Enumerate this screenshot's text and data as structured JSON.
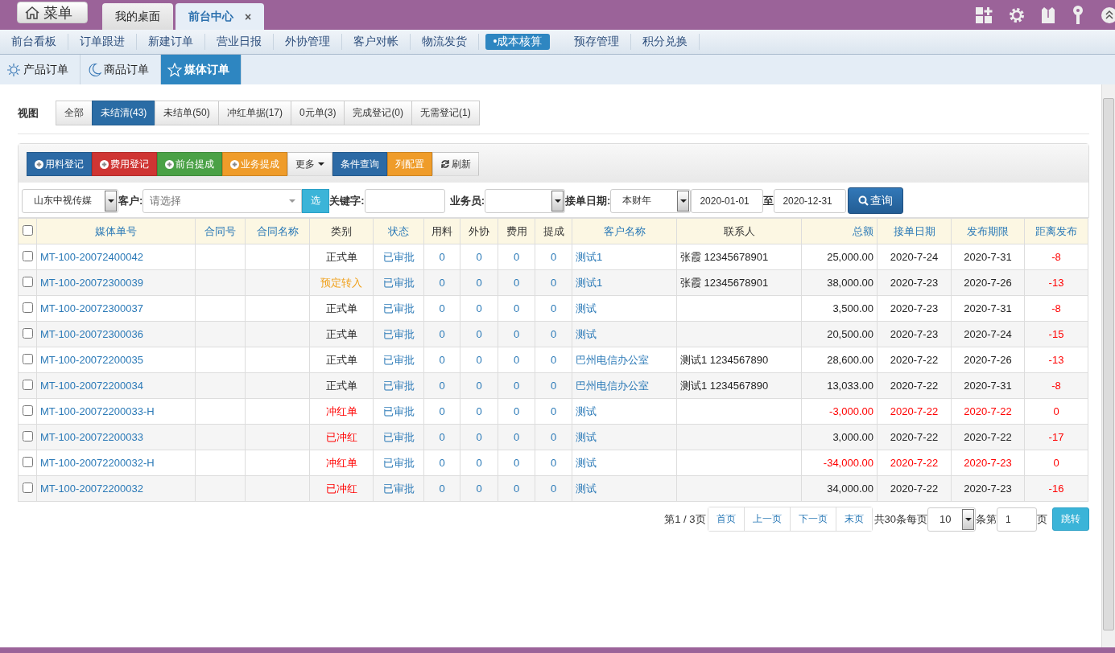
{
  "menu_button": "菜单",
  "window_tabs": [
    {
      "label": "我的桌面",
      "selected": false
    },
    {
      "label": "前台中心",
      "selected": true,
      "close": "×"
    }
  ],
  "nav": [
    {
      "label": "前台看板",
      "selected": false
    },
    {
      "label": "订单跟进",
      "selected": false
    },
    {
      "label": "新建订单",
      "selected": false
    },
    {
      "label": "营业日报",
      "selected": false
    },
    {
      "label": "外协管理",
      "selected": false
    },
    {
      "label": "客户对帐",
      "selected": false
    },
    {
      "label": "物流发货",
      "selected": false
    },
    {
      "label": "•成本核算",
      "selected": true
    },
    {
      "label": "预存管理",
      "selected": false
    },
    {
      "label": "积分兑换",
      "selected": false
    }
  ],
  "sub_tabs": [
    {
      "label": "产品订单",
      "selected": false
    },
    {
      "label": "商品订单",
      "selected": false
    },
    {
      "label": "媒体订单",
      "selected": true
    }
  ],
  "view": {
    "label": "视图",
    "options": [
      {
        "label": "全部",
        "selected": false
      },
      {
        "label": "未结清(43)",
        "selected": true
      },
      {
        "label": "未结单(50)",
        "selected": false
      },
      {
        "label": "冲红单据(17)",
        "selected": false
      },
      {
        "label": "0元单(3)",
        "selected": false
      },
      {
        "label": "完成登记(0)",
        "selected": false
      },
      {
        "label": "无需登记(1)",
        "selected": false
      }
    ]
  },
  "toolbar": [
    {
      "label": "用料登记",
      "kind": "primary"
    },
    {
      "label": "费用登记",
      "kind": "danger"
    },
    {
      "label": "前台提成",
      "kind": "success"
    },
    {
      "label": "业务提成",
      "kind": "warning"
    },
    {
      "label": "更多",
      "kind": "dropdown"
    },
    {
      "label": "条件查询",
      "kind": "primary"
    },
    {
      "label": "列配置",
      "kind": "warning"
    },
    {
      "label": "刷新",
      "kind": "default"
    }
  ],
  "filters": {
    "company": "山东中视传媒",
    "customer_label": "客户:",
    "customer_placeholder": "请选择",
    "pick_button": "选",
    "keyword_label": "关键字:",
    "salesman_label": "业务员:",
    "date_label": "接单日期:",
    "period": "本财年",
    "date_from": "2020-01-01",
    "to_label": "至",
    "date_to": "2020-12-31",
    "search_button": "查询"
  },
  "table": {
    "header_checked": false,
    "columns": [
      {
        "label": "媒体单号",
        "sortable": true
      },
      {
        "label": "合同号",
        "sortable": true
      },
      {
        "label": "合同名称",
        "sortable": true
      },
      {
        "label": "类别",
        "sortable": false
      },
      {
        "label": "状态",
        "sortable": true
      },
      {
        "label": "用料",
        "sortable": false
      },
      {
        "label": "外协",
        "sortable": false
      },
      {
        "label": "费用",
        "sortable": false
      },
      {
        "label": "提成",
        "sortable": false
      },
      {
        "label": "客户名称",
        "sortable": true
      },
      {
        "label": "联系人",
        "sortable": false
      },
      {
        "label": "总额",
        "sortable": true
      },
      {
        "label": "接单日期",
        "sortable": true
      },
      {
        "label": "发布期限",
        "sortable": true
      },
      {
        "label": "距离发布",
        "sortable": true
      }
    ],
    "rows": [
      {
        "checked": false,
        "kind": "normal",
        "cells": [
          "MT-100-20072400042",
          "",
          "",
          "正式单",
          "已审批",
          "0",
          "0",
          "0",
          "0",
          "测试1",
          "张霞 12345678901",
          "25,000.00",
          "2020-7-24",
          "2020-7-31",
          "-8"
        ]
      },
      {
        "checked": false,
        "kind": "reserved",
        "cells": [
          "MT-100-20072300039",
          "",
          "",
          "预定转入",
          "已审批",
          "0",
          "0",
          "0",
          "0",
          "测试1",
          "张霞 12345678901",
          "38,000.00",
          "2020-7-23",
          "2020-7-26",
          "-13"
        ]
      },
      {
        "checked": false,
        "kind": "normal",
        "cells": [
          "MT-100-20072300037",
          "",
          "",
          "正式单",
          "已审批",
          "0",
          "0",
          "0",
          "0",
          "测试",
          "",
          "3,500.00",
          "2020-7-23",
          "2020-7-31",
          "-8"
        ]
      },
      {
        "checked": false,
        "kind": "normal",
        "cells": [
          "MT-100-20072300036",
          "",
          "",
          "正式单",
          "已审批",
          "0",
          "0",
          "0",
          "0",
          "测试",
          "",
          "20,500.00",
          "2020-7-23",
          "2020-7-24",
          "-15"
        ]
      },
      {
        "checked": false,
        "kind": "normal",
        "cells": [
          "MT-100-20072200035",
          "",
          "",
          "正式单",
          "已审批",
          "0",
          "0",
          "0",
          "0",
          "巴州电信办公室",
          "测试1 1234567890",
          "28,600.00",
          "2020-7-22",
          "2020-7-26",
          "-13"
        ]
      },
      {
        "checked": false,
        "kind": "normal",
        "cells": [
          "MT-100-20072200034",
          "",
          "",
          "正式单",
          "已审批",
          "0",
          "0",
          "0",
          "0",
          "巴州电信办公室",
          "测试1 1234567890",
          "13,033.00",
          "2020-7-22",
          "2020-7-31",
          "-8"
        ]
      },
      {
        "checked": false,
        "kind": "reversal",
        "cells": [
          "MT-100-20072200033-H",
          "",
          "",
          "冲红单",
          "已审批",
          "0",
          "0",
          "0",
          "0",
          "测试",
          "",
          "-3,000.00",
          "2020-7-22",
          "2020-7-22",
          "0"
        ]
      },
      {
        "checked": false,
        "kind": "reversed",
        "cells": [
          "MT-100-20072200033",
          "",
          "",
          "已冲红",
          "已审批",
          "0",
          "0",
          "0",
          "0",
          "测试",
          "",
          "3,000.00",
          "2020-7-22",
          "2020-7-22",
          "-17"
        ]
      },
      {
        "checked": false,
        "kind": "reversal",
        "cells": [
          "MT-100-20072200032-H",
          "",
          "",
          "冲红单",
          "已审批",
          "0",
          "0",
          "0",
          "0",
          "测试",
          "",
          "-34,000.00",
          "2020-7-22",
          "2020-7-23",
          "0"
        ]
      },
      {
        "checked": false,
        "kind": "reversed",
        "cells": [
          "MT-100-20072200032",
          "",
          "",
          "已冲红",
          "已审批",
          "0",
          "0",
          "0",
          "0",
          "测试",
          "",
          "34,000.00",
          "2020-7-22",
          "2020-7-23",
          "-16"
        ]
      }
    ]
  },
  "pager": {
    "page_info": "第1 / 3页",
    "buttons": [
      "首页",
      "上一页",
      "下一页",
      "末页"
    ],
    "total_text": "共30条每页",
    "page_size": "10",
    "item_text": "条第",
    "page_input": "1",
    "page_suffix": "页",
    "go_button": "跳转"
  }
}
